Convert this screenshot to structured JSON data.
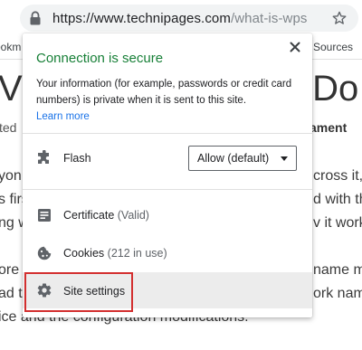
{
  "browser": {
    "url_host": "https://www.technipages.com",
    "url_path": "/what-is-wps",
    "bookmarks_left": "ookm",
    "bookmarks_right": "Sources"
  },
  "background_page": {
    "heading_left": "Vh",
    "heading_right": "y Do",
    "meta_left": "ted",
    "meta_right": "ament",
    "lines_left": [
      "yon",
      "s firs",
      "ng w",
      "ore",
      "ad t",
      "ice and the configuration modifications."
    ],
    "lines_right": [
      "cross it,",
      "d with th",
      "v it work",
      "name m",
      "ork name"
    ]
  },
  "popup": {
    "title": "Connection is secure",
    "description": "Your information (for example, passwords or credit card numbers) is private when it is sent to this site.",
    "learn_more": "Learn more",
    "flash_label": "Flash",
    "flash_value": "Allow (default)",
    "certificate_label": "Certificate",
    "certificate_status": "(Valid)",
    "cookies_label": "Cookies",
    "cookies_status": "(212 in use)",
    "site_settings_label": "Site settings"
  },
  "colors": {
    "secure_green": "#188038",
    "link_blue": "#1a73e8",
    "highlight_red": "#d32f2f"
  },
  "icons": [
    "lock-icon",
    "star-icon",
    "close-icon",
    "puzzle-icon",
    "certificate-icon",
    "cookie-icon",
    "gear-icon",
    "chevron-down-icon"
  ]
}
